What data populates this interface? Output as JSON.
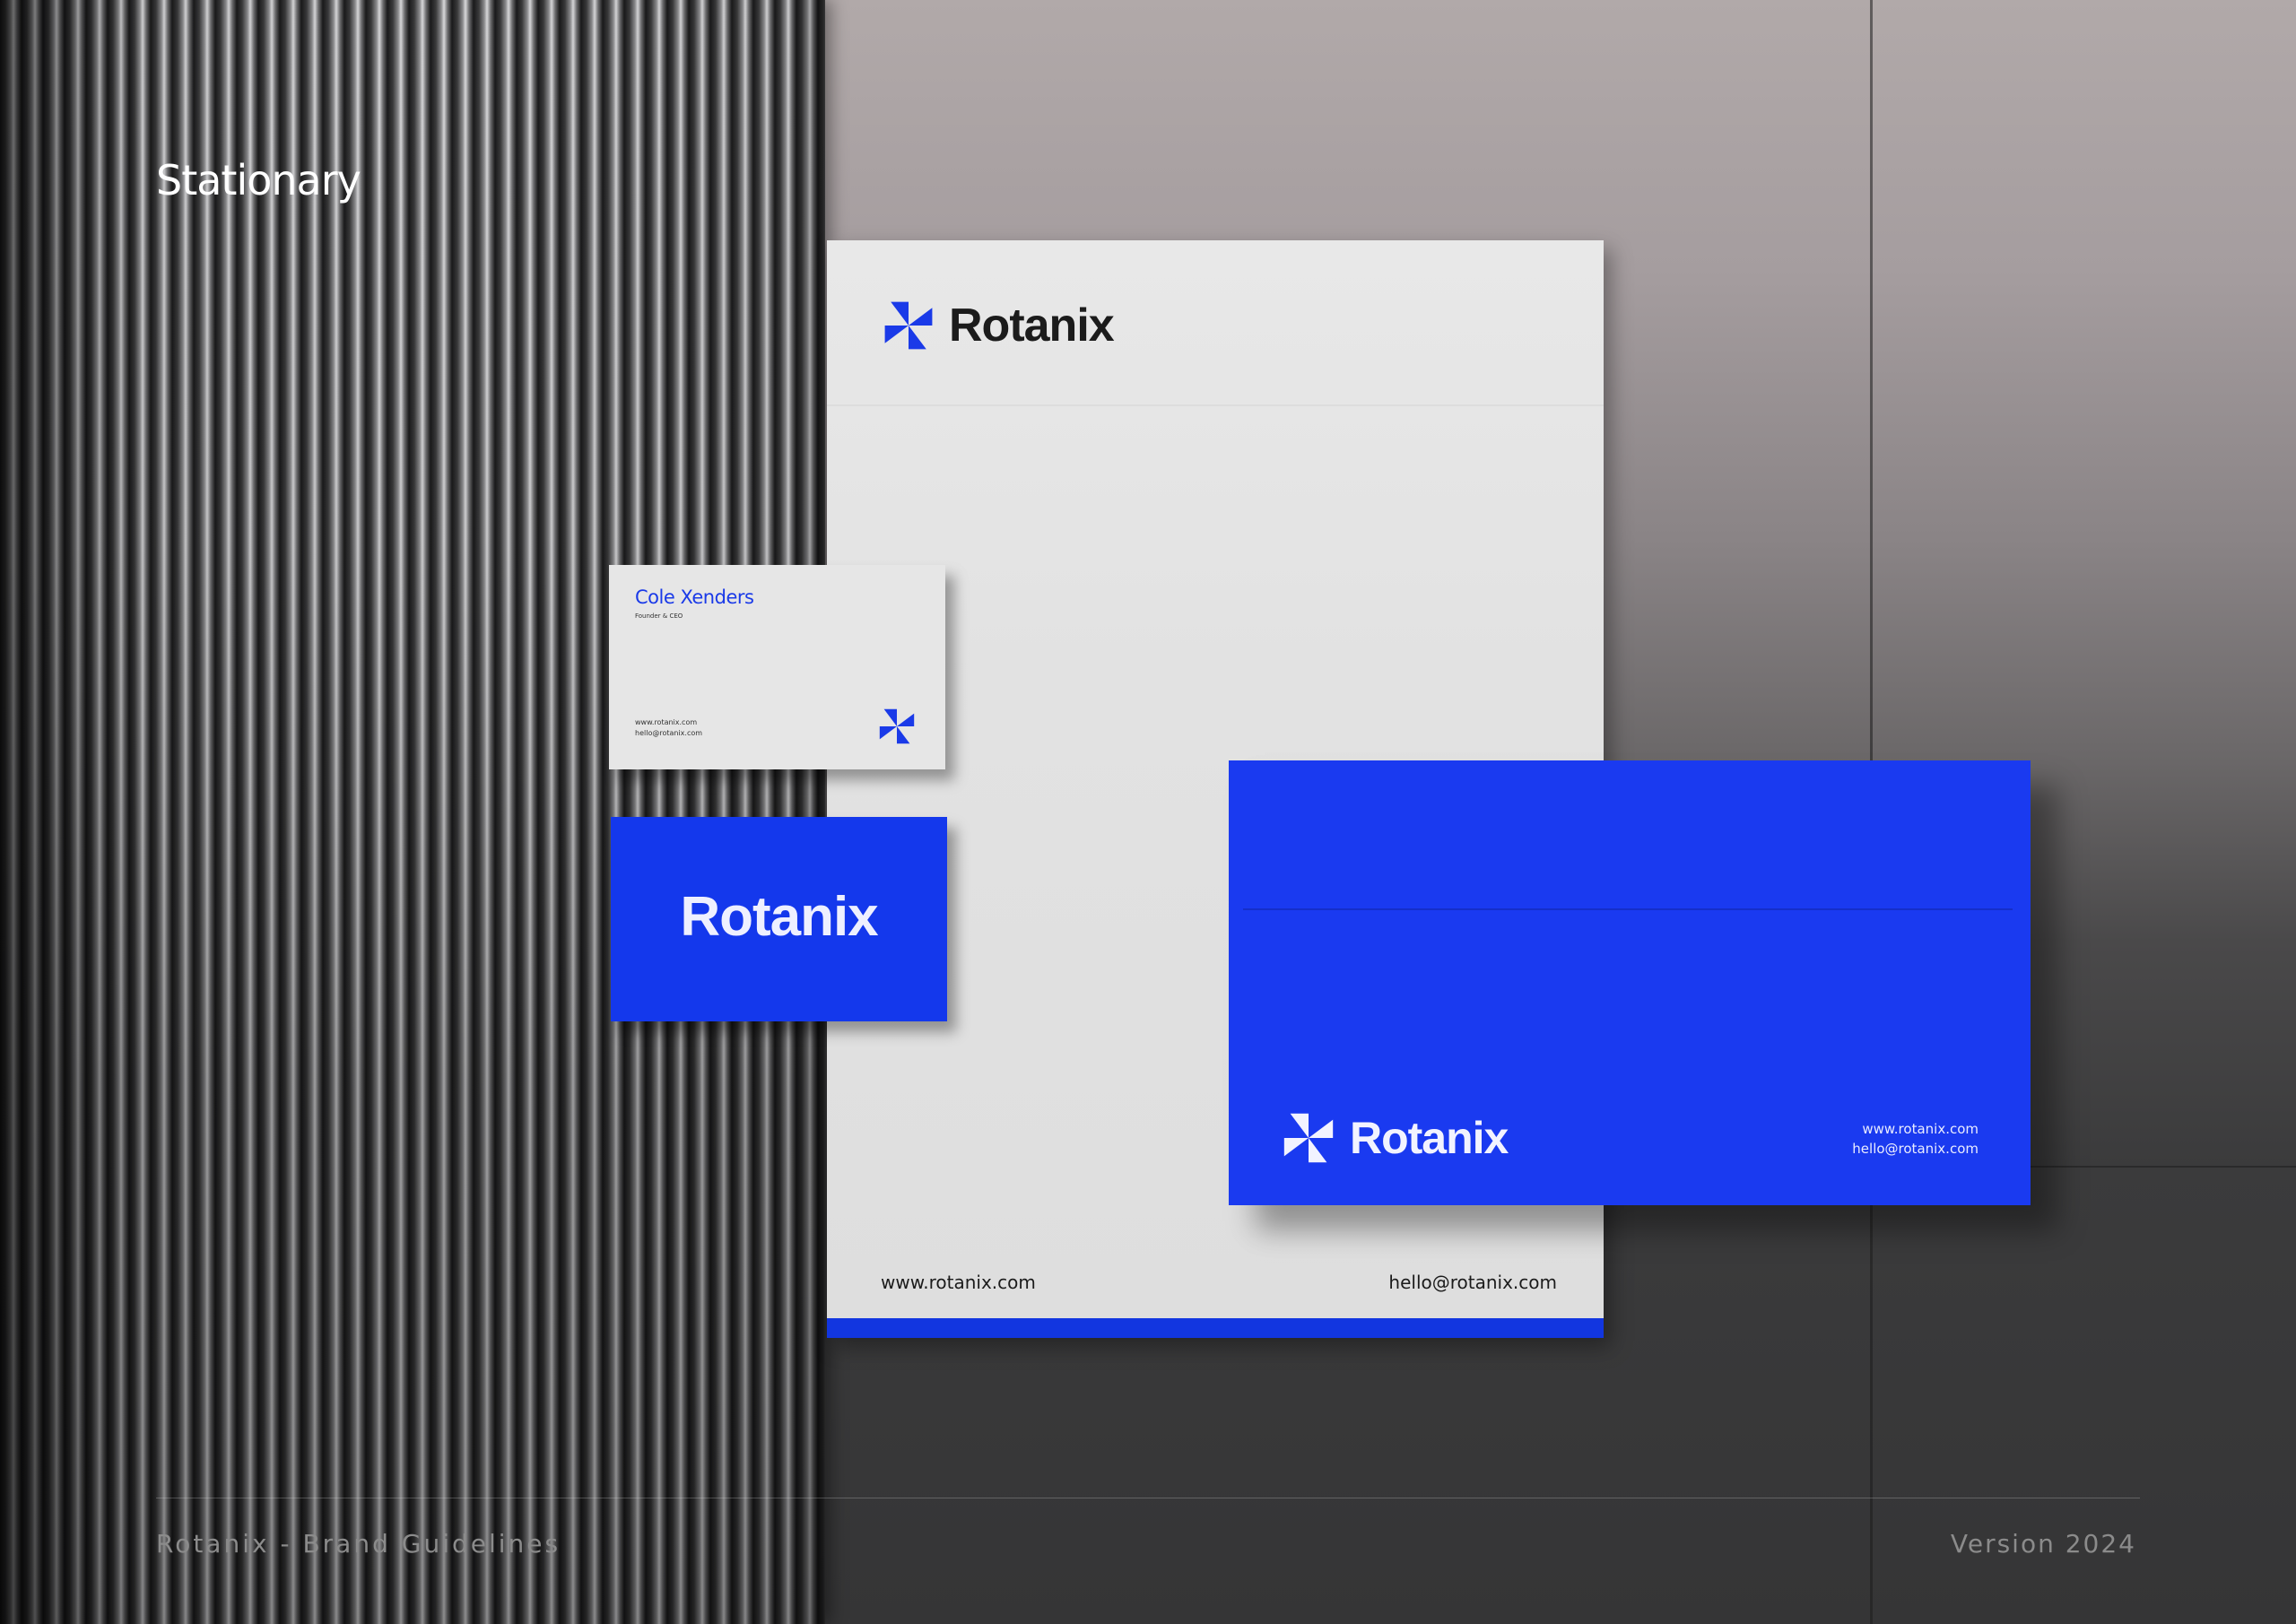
{
  "page": {
    "title": "Stationary",
    "footer_left": "Rotanix - Brand Guidelines",
    "footer_right": "Version 2024"
  },
  "brand": {
    "name": "Rotanix",
    "website": "www.rotanix.com",
    "email": "hello@rotanix.com",
    "accent_color": "#1A3AF0",
    "logo_icon": "pinwheel-icon"
  },
  "business_card": {
    "name": "Cole Xenders",
    "role": "Founder & CEO",
    "website": "www.rotanix.com",
    "email": "hello@rotanix.com"
  }
}
